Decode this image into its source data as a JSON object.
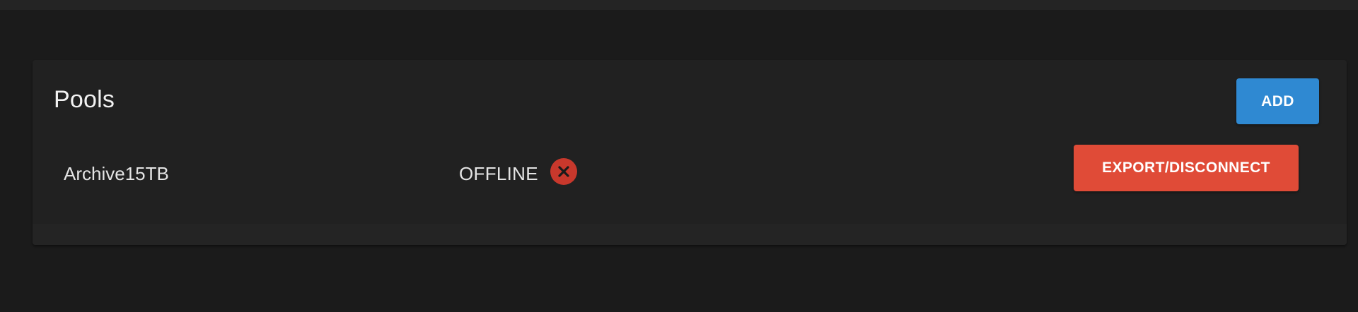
{
  "pools_card": {
    "title": "Pools",
    "add_label": "ADD"
  },
  "pools": [
    {
      "name": "Archive15TB",
      "status": "OFFLINE",
      "status_icon": "x-circle-icon",
      "status_color": "#c8382c",
      "action_label": "EXPORT/DISCONNECT"
    }
  ],
  "colors": {
    "background": "#1b1b1b",
    "card": "#212121",
    "primary": "#2f89d2",
    "danger": "#e04b37"
  }
}
